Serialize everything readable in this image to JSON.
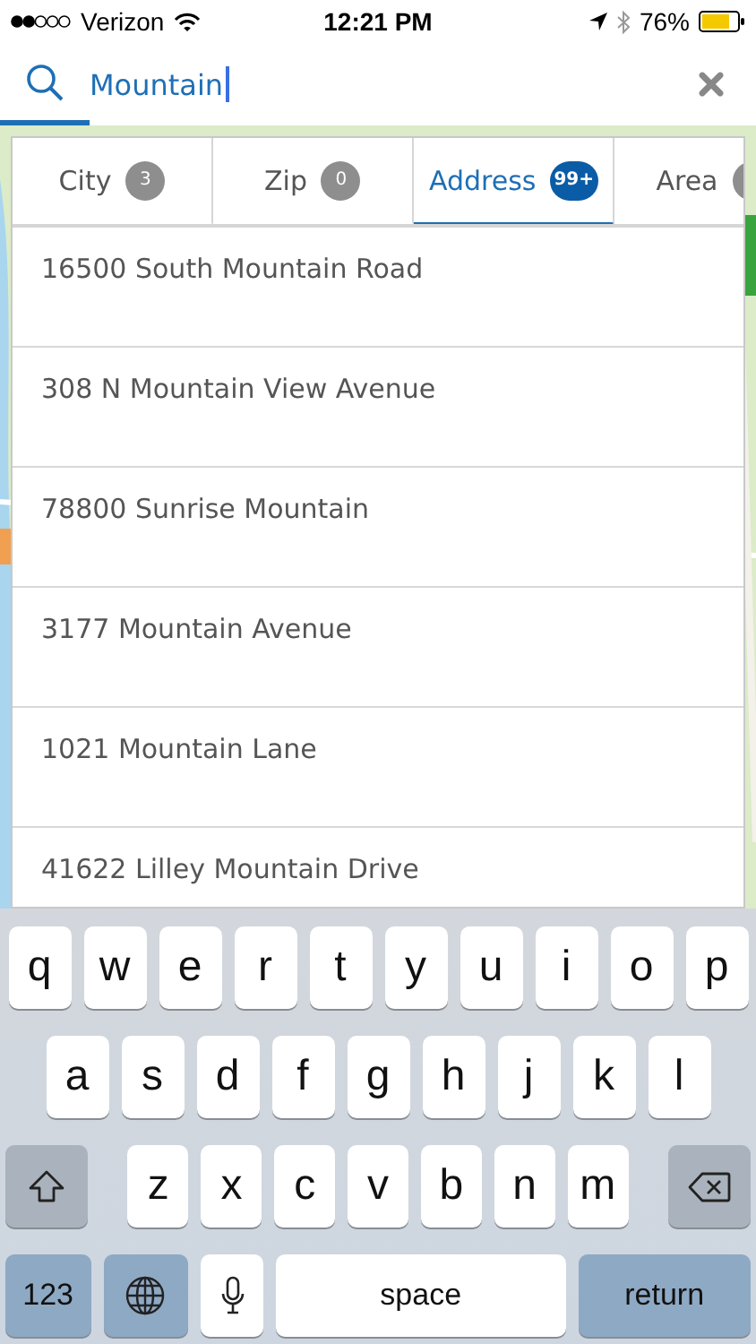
{
  "status_bar": {
    "carrier": "Verizon",
    "time": "12:21 PM",
    "battery": "76%"
  },
  "search": {
    "value": "Mountain",
    "focused": true
  },
  "tabs": [
    {
      "label": "City",
      "count": "3",
      "selected": false
    },
    {
      "label": "Zip",
      "count": "0",
      "selected": false
    },
    {
      "label": "Address",
      "count": "99+",
      "selected": true
    },
    {
      "label": "Area",
      "badge_cut": true,
      "selected": false
    }
  ],
  "results": [
    "16500 South Mountain Road",
    "308 N Mountain View Avenue",
    "78800 Sunrise Mountain",
    "3177 Mountain Avenue",
    "1021 Mountain Lane",
    "41622 Lilley Mountain Drive"
  ],
  "keyboard": {
    "rows": [
      [
        {
          "kind": "letter",
          "label": "q"
        },
        {
          "kind": "letter",
          "label": "w"
        },
        {
          "kind": "letter",
          "label": "e"
        },
        {
          "kind": "letter",
          "label": "r"
        },
        {
          "kind": "letter",
          "label": "t"
        },
        {
          "kind": "letter",
          "label": "y"
        },
        {
          "kind": "letter",
          "label": "u"
        },
        {
          "kind": "letter",
          "label": "i"
        },
        {
          "kind": "letter",
          "label": "o"
        },
        {
          "kind": "letter",
          "label": "p"
        }
      ],
      [
        {
          "kind": "letter",
          "label": "a"
        },
        {
          "kind": "letter",
          "label": "s"
        },
        {
          "kind": "letter",
          "label": "d"
        },
        {
          "kind": "letter",
          "label": "f"
        },
        {
          "kind": "letter",
          "label": "g"
        },
        {
          "kind": "letter",
          "label": "h"
        },
        {
          "kind": "letter",
          "label": "j"
        },
        {
          "kind": "letter",
          "label": "k"
        },
        {
          "kind": "letter",
          "label": "l"
        }
      ],
      [
        {
          "kind": "shift"
        },
        {
          "kind": "letter",
          "label": "z"
        },
        {
          "kind": "letter",
          "label": "x"
        },
        {
          "kind": "letter",
          "label": "c"
        },
        {
          "kind": "letter",
          "label": "v"
        },
        {
          "kind": "letter",
          "label": "b"
        },
        {
          "kind": "letter",
          "label": "n"
        },
        {
          "kind": "letter",
          "label": "m"
        },
        {
          "kind": "delete"
        }
      ]
    ],
    "bottom_bar": [
      {
        "kind": "numbers",
        "label": "123"
      },
      {
        "kind": "globe"
      },
      {
        "kind": "mic"
      },
      {
        "kind": "space",
        "label": "space"
      },
      {
        "kind": "return",
        "label": "return"
      }
    ]
  }
}
